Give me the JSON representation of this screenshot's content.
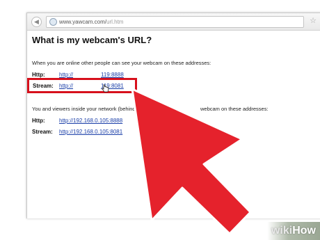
{
  "browser": {
    "url_domain": "www.yawcam.com/",
    "url_path": "url.htm",
    "back_icon": "back-arrow-icon",
    "forward_icon": "forward-arrow-icon",
    "star_icon": "star-icon"
  },
  "page": {
    "title": "What is my webcam's URL?",
    "online_intro": "When you are online other people can see your webcam on these addresses:",
    "online_http_label": "Http:",
    "online_http_link_a": "http://",
    "online_http_link_b": "119:8888",
    "online_stream_label": "Stream:",
    "online_stream_link_a": "http://",
    "online_stream_link_b": "119:8081",
    "network_intro_a": "You and viewers inside your network (behind y",
    "network_intro_b": "webcam on these addresses:",
    "network_http_label": "Http:",
    "network_http_link": "http://192.168.0.105:8888",
    "network_stream_label": "Stream:",
    "network_stream_link": "http://192.168.0.105:8081"
  },
  "colors": {
    "highlight": "#d7101c",
    "arrow": "#e5222c",
    "link": "#1a3ea8"
  },
  "watermark": {
    "wiki": "wiki",
    "how": "How"
  }
}
